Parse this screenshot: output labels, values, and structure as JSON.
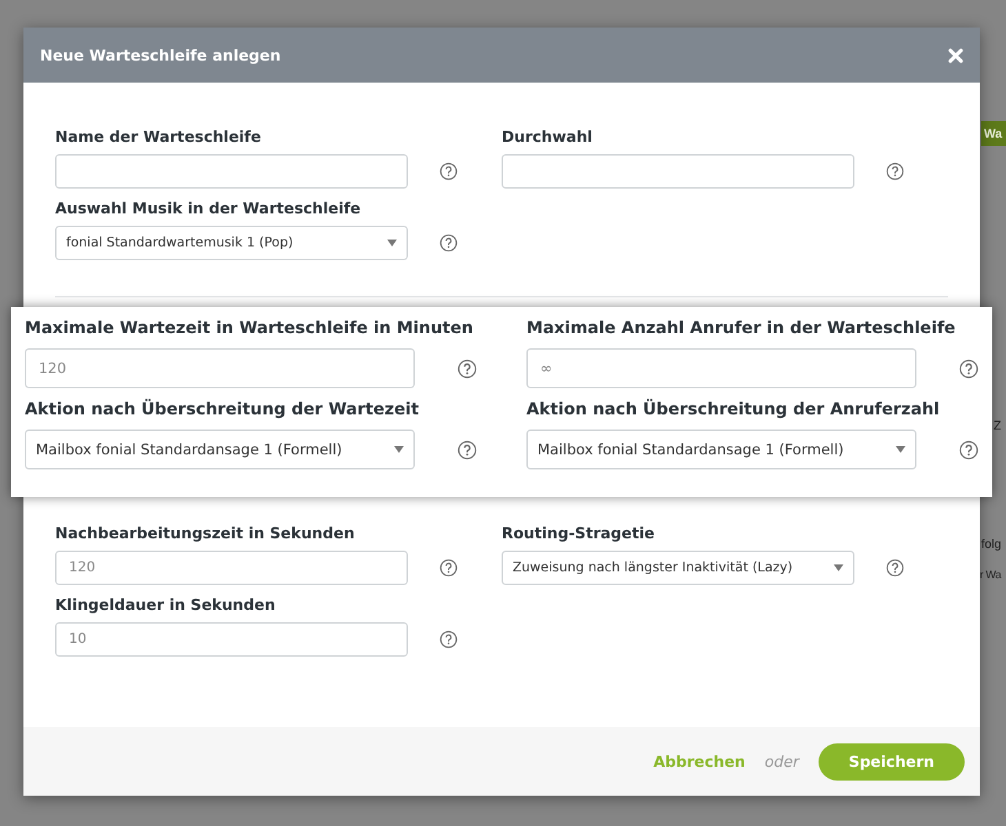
{
  "background": {
    "fragments": [
      {
        "kind": "button",
        "text": "Wa"
      },
      {
        "kind": "text",
        "text": "Z"
      },
      {
        "kind": "text",
        "text": "folg"
      },
      {
        "kind": "text",
        "text": "r Wa"
      }
    ]
  },
  "dialog": {
    "title": "Neue Warteschleife anlegen",
    "sections": [
      {
        "kind": "normal",
        "rows": [
          [
            {
              "label": "Name der Warteschleife",
              "kind": "input"
            },
            {
              "label": "Durchwahl",
              "kind": "input"
            }
          ],
          [
            {
              "label": "Auswahl Musik in der Warteschleife",
              "kind": "select",
              "value": "fonial Standardwartemusik 1 (Pop)"
            }
          ]
        ]
      },
      {
        "kind": "highlighted",
        "rows": [
          [
            {
              "label": "Maximale Wartezeit in Warteschleife in Minuten",
              "kind": "input",
              "placeholder": "120"
            },
            {
              "label": "Maximale Anzahl Anrufer in der Warteschleife",
              "kind": "input",
              "placeholder": "∞"
            }
          ],
          [
            {
              "label": "Aktion nach Überschreitung der Wartezeit",
              "kind": "select",
              "value": "Mailbox fonial Standardansage 1 (Formell)"
            },
            {
              "label": "Aktion nach Überschreitung der Anruferzahl",
              "kind": "select",
              "value": "Mailbox fonial Standardansage 1 (Formell)"
            }
          ]
        ]
      },
      {
        "kind": "normal",
        "rows": [
          [
            {
              "label": "Nachbearbeitungszeit in Sekunden",
              "kind": "input",
              "placeholder": "120"
            },
            {
              "label": "Routing-Stragetie",
              "kind": "select",
              "value": "Zuweisung nach längster Inaktivität (Lazy)"
            }
          ],
          [
            {
              "label": "Klingeldauer in Sekunden",
              "kind": "input",
              "placeholder": "10"
            }
          ]
        ]
      }
    ],
    "footer": {
      "cancel": "Abbrechen",
      "separator": "oder",
      "save": "Speichern"
    }
  }
}
